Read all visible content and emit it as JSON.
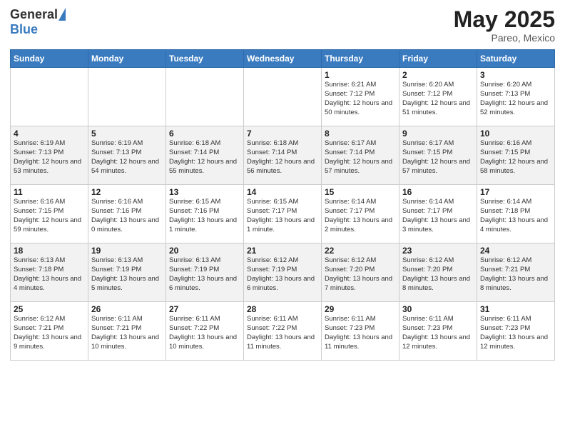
{
  "header": {
    "logo_general": "General",
    "logo_blue": "Blue",
    "month_year": "May 2025",
    "location": "Pareo, Mexico"
  },
  "days_of_week": [
    "Sunday",
    "Monday",
    "Tuesday",
    "Wednesday",
    "Thursday",
    "Friday",
    "Saturday"
  ],
  "weeks": [
    [
      {
        "day": "",
        "sunrise": "",
        "sunset": "",
        "daylight": ""
      },
      {
        "day": "",
        "sunrise": "",
        "sunset": "",
        "daylight": ""
      },
      {
        "day": "",
        "sunrise": "",
        "sunset": "",
        "daylight": ""
      },
      {
        "day": "",
        "sunrise": "",
        "sunset": "",
        "daylight": ""
      },
      {
        "day": "1",
        "sunrise": "Sunrise: 6:21 AM",
        "sunset": "Sunset: 7:12 PM",
        "daylight": "Daylight: 12 hours and 50 minutes."
      },
      {
        "day": "2",
        "sunrise": "Sunrise: 6:20 AM",
        "sunset": "Sunset: 7:12 PM",
        "daylight": "Daylight: 12 hours and 51 minutes."
      },
      {
        "day": "3",
        "sunrise": "Sunrise: 6:20 AM",
        "sunset": "Sunset: 7:13 PM",
        "daylight": "Daylight: 12 hours and 52 minutes."
      }
    ],
    [
      {
        "day": "4",
        "sunrise": "Sunrise: 6:19 AM",
        "sunset": "Sunset: 7:13 PM",
        "daylight": "Daylight: 12 hours and 53 minutes."
      },
      {
        "day": "5",
        "sunrise": "Sunrise: 6:19 AM",
        "sunset": "Sunset: 7:13 PM",
        "daylight": "Daylight: 12 hours and 54 minutes."
      },
      {
        "day": "6",
        "sunrise": "Sunrise: 6:18 AM",
        "sunset": "Sunset: 7:14 PM",
        "daylight": "Daylight: 12 hours and 55 minutes."
      },
      {
        "day": "7",
        "sunrise": "Sunrise: 6:18 AM",
        "sunset": "Sunset: 7:14 PM",
        "daylight": "Daylight: 12 hours and 56 minutes."
      },
      {
        "day": "8",
        "sunrise": "Sunrise: 6:17 AM",
        "sunset": "Sunset: 7:14 PM",
        "daylight": "Daylight: 12 hours and 57 minutes."
      },
      {
        "day": "9",
        "sunrise": "Sunrise: 6:17 AM",
        "sunset": "Sunset: 7:15 PM",
        "daylight": "Daylight: 12 hours and 57 minutes."
      },
      {
        "day": "10",
        "sunrise": "Sunrise: 6:16 AM",
        "sunset": "Sunset: 7:15 PM",
        "daylight": "Daylight: 12 hours and 58 minutes."
      }
    ],
    [
      {
        "day": "11",
        "sunrise": "Sunrise: 6:16 AM",
        "sunset": "Sunset: 7:15 PM",
        "daylight": "Daylight: 12 hours and 59 minutes."
      },
      {
        "day": "12",
        "sunrise": "Sunrise: 6:16 AM",
        "sunset": "Sunset: 7:16 PM",
        "daylight": "Daylight: 13 hours and 0 minutes."
      },
      {
        "day": "13",
        "sunrise": "Sunrise: 6:15 AM",
        "sunset": "Sunset: 7:16 PM",
        "daylight": "Daylight: 13 hours and 1 minute."
      },
      {
        "day": "14",
        "sunrise": "Sunrise: 6:15 AM",
        "sunset": "Sunset: 7:17 PM",
        "daylight": "Daylight: 13 hours and 1 minute."
      },
      {
        "day": "15",
        "sunrise": "Sunrise: 6:14 AM",
        "sunset": "Sunset: 7:17 PM",
        "daylight": "Daylight: 13 hours and 2 minutes."
      },
      {
        "day": "16",
        "sunrise": "Sunrise: 6:14 AM",
        "sunset": "Sunset: 7:17 PM",
        "daylight": "Daylight: 13 hours and 3 minutes."
      },
      {
        "day": "17",
        "sunrise": "Sunrise: 6:14 AM",
        "sunset": "Sunset: 7:18 PM",
        "daylight": "Daylight: 13 hours and 4 minutes."
      }
    ],
    [
      {
        "day": "18",
        "sunrise": "Sunrise: 6:13 AM",
        "sunset": "Sunset: 7:18 PM",
        "daylight": "Daylight: 13 hours and 4 minutes."
      },
      {
        "day": "19",
        "sunrise": "Sunrise: 6:13 AM",
        "sunset": "Sunset: 7:19 PM",
        "daylight": "Daylight: 13 hours and 5 minutes."
      },
      {
        "day": "20",
        "sunrise": "Sunrise: 6:13 AM",
        "sunset": "Sunset: 7:19 PM",
        "daylight": "Daylight: 13 hours and 6 minutes."
      },
      {
        "day": "21",
        "sunrise": "Sunrise: 6:12 AM",
        "sunset": "Sunset: 7:19 PM",
        "daylight": "Daylight: 13 hours and 6 minutes."
      },
      {
        "day": "22",
        "sunrise": "Sunrise: 6:12 AM",
        "sunset": "Sunset: 7:20 PM",
        "daylight": "Daylight: 13 hours and 7 minutes."
      },
      {
        "day": "23",
        "sunrise": "Sunrise: 6:12 AM",
        "sunset": "Sunset: 7:20 PM",
        "daylight": "Daylight: 13 hours and 8 minutes."
      },
      {
        "day": "24",
        "sunrise": "Sunrise: 6:12 AM",
        "sunset": "Sunset: 7:21 PM",
        "daylight": "Daylight: 13 hours and 8 minutes."
      }
    ],
    [
      {
        "day": "25",
        "sunrise": "Sunrise: 6:12 AM",
        "sunset": "Sunset: 7:21 PM",
        "daylight": "Daylight: 13 hours and 9 minutes."
      },
      {
        "day": "26",
        "sunrise": "Sunrise: 6:11 AM",
        "sunset": "Sunset: 7:21 PM",
        "daylight": "Daylight: 13 hours and 10 minutes."
      },
      {
        "day": "27",
        "sunrise": "Sunrise: 6:11 AM",
        "sunset": "Sunset: 7:22 PM",
        "daylight": "Daylight: 13 hours and 10 minutes."
      },
      {
        "day": "28",
        "sunrise": "Sunrise: 6:11 AM",
        "sunset": "Sunset: 7:22 PM",
        "daylight": "Daylight: 13 hours and 11 minutes."
      },
      {
        "day": "29",
        "sunrise": "Sunrise: 6:11 AM",
        "sunset": "Sunset: 7:23 PM",
        "daylight": "Daylight: 13 hours and 11 minutes."
      },
      {
        "day": "30",
        "sunrise": "Sunrise: 6:11 AM",
        "sunset": "Sunset: 7:23 PM",
        "daylight": "Daylight: 13 hours and 12 minutes."
      },
      {
        "day": "31",
        "sunrise": "Sunrise: 6:11 AM",
        "sunset": "Sunset: 7:23 PM",
        "daylight": "Daylight: 13 hours and 12 minutes."
      }
    ]
  ]
}
